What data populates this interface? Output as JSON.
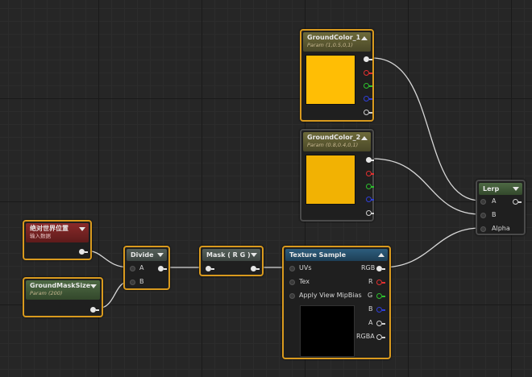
{
  "colors": {
    "accent_border": "#d99a1e",
    "swatch": "#ffbe05",
    "wire": "#d8d8d8",
    "pin_r": "#e23030",
    "pin_g": "#2ec02e",
    "pin_b": "#2f3fd8"
  },
  "nodes": {
    "groundcolor1": {
      "title": "GroundColor_1",
      "subtitle": "Param (1,0.5,0,1)"
    },
    "groundcolor2": {
      "title": "GroundColor_2",
      "subtitle": "Param (0.8,0.4,0,1)"
    },
    "world_pos": {
      "title": "绝对世界位置",
      "subtitle": "输入数据"
    },
    "ground_mask_size": {
      "title": "GroundMaskSize",
      "subtitle": "Param (200)"
    },
    "divide": {
      "title": "Divide",
      "pin_a": "A",
      "pin_b": "B"
    },
    "mask": {
      "title": "Mask ( R G )"
    },
    "texture_sample": {
      "title": "Texture Sample",
      "in_uvs": "UVs",
      "in_tex": "Tex",
      "in_mip": "Apply View MipBias",
      "out_rgb": "RGB",
      "out_r": "R",
      "out_g": "G",
      "out_b": "B",
      "out_a": "A",
      "out_rgba": "RGBA"
    },
    "lerp": {
      "title": "Lerp",
      "pin_a": "A",
      "pin_b": "B",
      "pin_alpha": "Alpha"
    }
  }
}
